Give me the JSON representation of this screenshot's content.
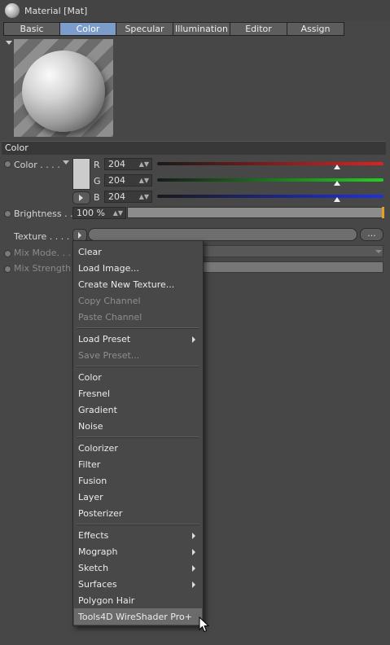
{
  "window": {
    "title": "Material [Mat]"
  },
  "tabs": [
    {
      "label": "Basic",
      "active": false
    },
    {
      "label": "Color",
      "active": true
    },
    {
      "label": "Specular",
      "active": false
    },
    {
      "label": "Illumination",
      "active": false
    },
    {
      "label": "Editor",
      "active": false
    },
    {
      "label": "Assign",
      "active": false
    }
  ],
  "section": {
    "title": "Color"
  },
  "color": {
    "label": "Color . . . .",
    "swatch_hex": "#cccccc",
    "r_label": "R",
    "r_value": "204",
    "r_fraction": 0.8,
    "g_label": "G",
    "g_value": "204",
    "g_fraction": 0.8,
    "b_label": "B",
    "b_value": "204",
    "b_fraction": 0.8
  },
  "brightness": {
    "label": "Brightness . .",
    "value": "100 %",
    "fraction": 1.0
  },
  "texture": {
    "label": "Texture . . . . .",
    "more_label": "..."
  },
  "mix_mode": {
    "label": "Mix Mode. . . ."
  },
  "mix_strength": {
    "label": "Mix Strength"
  },
  "menu": {
    "items": [
      {
        "label": "Clear"
      },
      {
        "label": "Load Image..."
      },
      {
        "label": "Create New Texture..."
      },
      {
        "label": "Copy Channel",
        "disabled": true
      },
      {
        "label": "Paste Channel",
        "disabled": true
      },
      {
        "label": "Load Preset",
        "submenu": true
      },
      {
        "label": "Save Preset...",
        "disabled": true
      },
      {
        "label": "Color"
      },
      {
        "label": "Fresnel"
      },
      {
        "label": "Gradient"
      },
      {
        "label": "Noise"
      },
      {
        "label": "Colorizer"
      },
      {
        "label": "Filter"
      },
      {
        "label": "Fusion"
      },
      {
        "label": "Layer"
      },
      {
        "label": "Posterizer"
      },
      {
        "label": "Effects",
        "submenu": true
      },
      {
        "label": "Mograph",
        "submenu": true
      },
      {
        "label": "Sketch",
        "submenu": true
      },
      {
        "label": "Surfaces",
        "submenu": true
      },
      {
        "label": "Polygon Hair"
      },
      {
        "label": "Tools4D WireShader Pro+",
        "highlighted": true
      }
    ]
  },
  "colors": {
    "accent": "#7c9ccc",
    "bg": "#474747",
    "brightness_marker": "#e8a020"
  }
}
